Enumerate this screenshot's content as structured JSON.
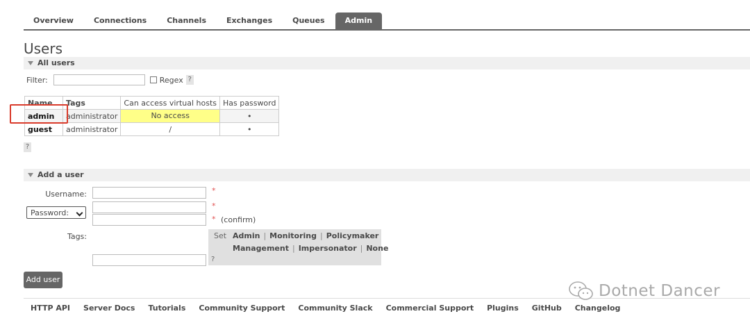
{
  "nav": {
    "tabs": [
      "Overview",
      "Connections",
      "Channels",
      "Exchanges",
      "Queues",
      "Admin"
    ],
    "active": "Admin"
  },
  "page": {
    "title": "Users"
  },
  "all_users": {
    "heading": "All users",
    "filter_label": "Filter:",
    "filter_value": "",
    "regex_label": "Regex",
    "help": "?",
    "columns": [
      "Name",
      "Tags",
      "Can access virtual hosts",
      "Has password"
    ],
    "rows": [
      {
        "name": "admin",
        "tags": "administrator",
        "vhosts": "No access",
        "has_password": "•"
      },
      {
        "name": "guest",
        "tags": "administrator",
        "vhosts": "/",
        "has_password": "•"
      }
    ]
  },
  "add_user": {
    "heading": "Add a user",
    "username_label": "Username:",
    "password_select": "Password:",
    "required": "*",
    "confirm": "(confirm)",
    "tags_label": "Tags:",
    "set_label": "Set",
    "tag_options": [
      "Admin",
      "Monitoring",
      "Policymaker",
      "Management",
      "Impersonator",
      "None"
    ],
    "help": "?",
    "button": "Add user"
  },
  "footer": {
    "links": [
      "HTTP API",
      "Server Docs",
      "Tutorials",
      "Community Support",
      "Community Slack",
      "Commercial Support",
      "Plugins",
      "GitHub",
      "Changelog"
    ]
  },
  "watermark": {
    "text": "Dotnet Dancer"
  },
  "colors": {
    "tab_active": "#666666",
    "no_access": "#ffff88",
    "highlight_box": "#d93a2a"
  }
}
